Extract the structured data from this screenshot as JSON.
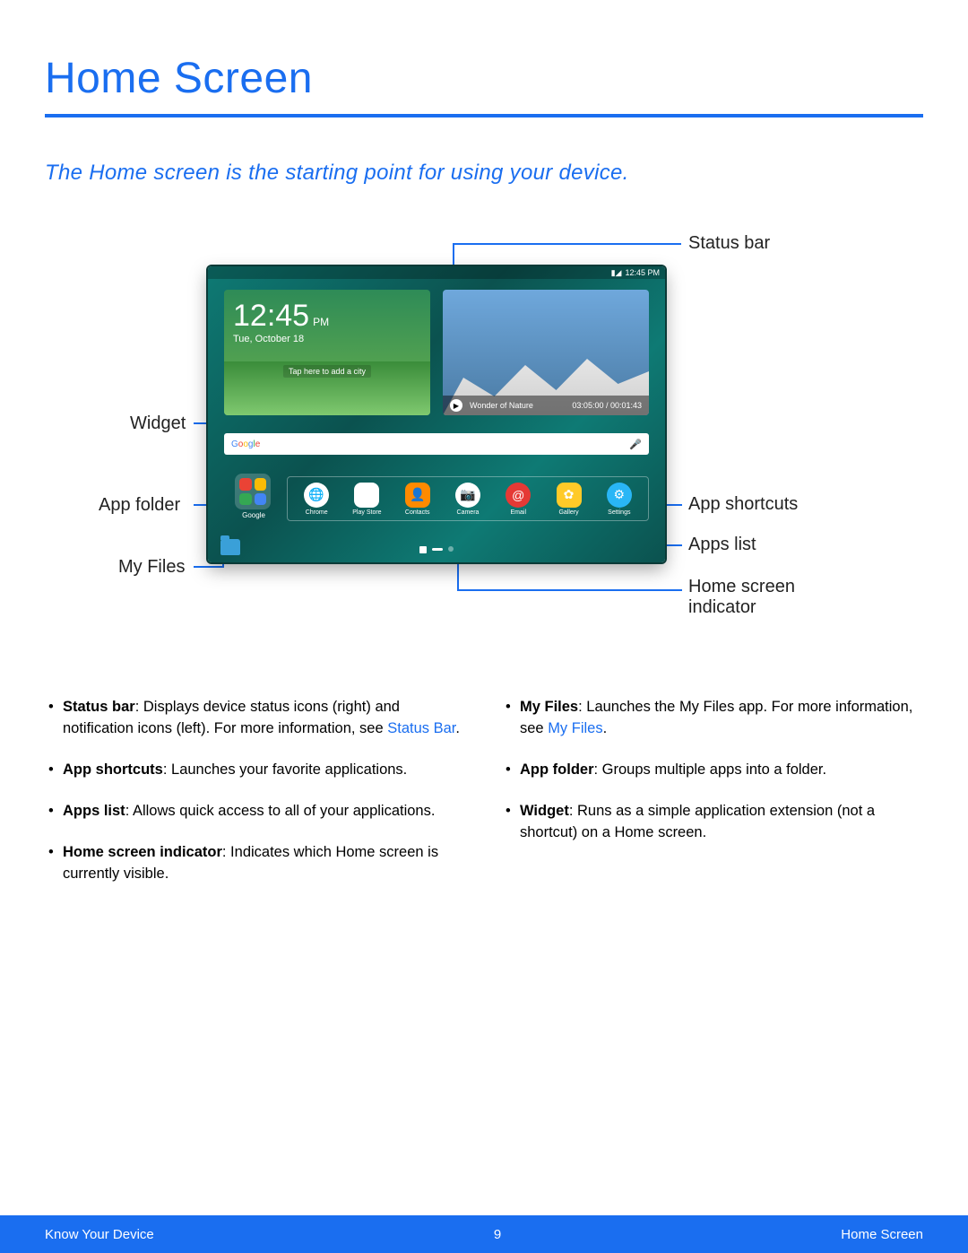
{
  "title": "Home Screen",
  "subtitle": "The Home screen is the starting point for using your device.",
  "tablet": {
    "status_time": "12:45 PM",
    "wifi": "▮◢",
    "clock": {
      "time": "12:45",
      "ampm": "PM",
      "date": "Tue, October 18",
      "tap": "Tap here to add a city"
    },
    "video": {
      "title": "Wonder of Nature",
      "time": "03:05:00 / 00:01:43"
    },
    "search_logo": "Google",
    "folder_label": "Google",
    "apps": [
      {
        "label": "Chrome",
        "color": "#fff"
      },
      {
        "label": "Play Store",
        "color": "#fff"
      },
      {
        "label": "Contacts",
        "color": "#ff8a00"
      },
      {
        "label": "Camera",
        "color": "#fff"
      },
      {
        "label": "Email",
        "color": "#e53935"
      },
      {
        "label": "Gallery",
        "color": "#ffca28"
      },
      {
        "label": "Settings",
        "color": "#29b6f6"
      }
    ]
  },
  "callouts": {
    "status_bar": "Status bar",
    "widget": "Widget",
    "app_folder": "App folder",
    "my_files": "My Files",
    "app_shortcuts": "App shortcuts",
    "apps_list": "Apps list",
    "home_indicator": "Home screen indicator"
  },
  "bullets_left": [
    {
      "bold": "Status bar",
      "text": ": Displays device status icons (right) and notification icons (left). For more information, see ",
      "link": "Status Bar",
      "after": "."
    },
    {
      "bold": "App shortcuts",
      "text": ": Launches your favorite applications."
    },
    {
      "bold": "Apps list",
      "text": ": Allows quick access to all of your applications."
    },
    {
      "bold": "Home screen indicator",
      "text": ": Indicates which Home screen is currently visible."
    }
  ],
  "bullets_right": [
    {
      "bold": "My Files",
      "text": ": Launches the My Files app. For more information, see ",
      "link": "My Files",
      "after": "."
    },
    {
      "bold": "App folder",
      "text": ": Groups multiple apps into a folder."
    },
    {
      "bold": "Widget",
      "text": ": Runs as a simple application extension (not a shortcut) on a Home screen."
    }
  ],
  "footer": {
    "left": "Know Your Device",
    "center": "9",
    "right": "Home Screen"
  }
}
